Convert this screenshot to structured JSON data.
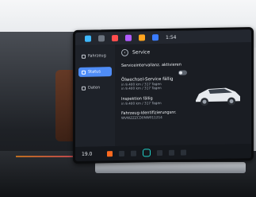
{
  "topbar": {
    "clock": "1:54"
  },
  "sidebar": {
    "items": [
      {
        "label": "Fahrzeug"
      },
      {
        "label": "Status"
      },
      {
        "label": "Daten"
      }
    ]
  },
  "main": {
    "title": "Service",
    "rows": [
      {
        "title": "Serviceintervallanz. aktivieren"
      },
      {
        "title": "Ölwechsel-Service fällig",
        "sub1": "in 9.400 km / 317 Tagen",
        "sub2": "in 9.400 km / 317 Tagen"
      },
      {
        "title": "Inspektion fällig",
        "sub1": "in 9.400 km / 317 Tagen"
      },
      {
        "title": "Fahrzeug-Identifizierungsnr.",
        "sub1": "WVWZZZCD0NW011214"
      }
    ]
  },
  "bottombar": {
    "temperature": "19.0",
    "accent_color": "#21d1c9"
  }
}
